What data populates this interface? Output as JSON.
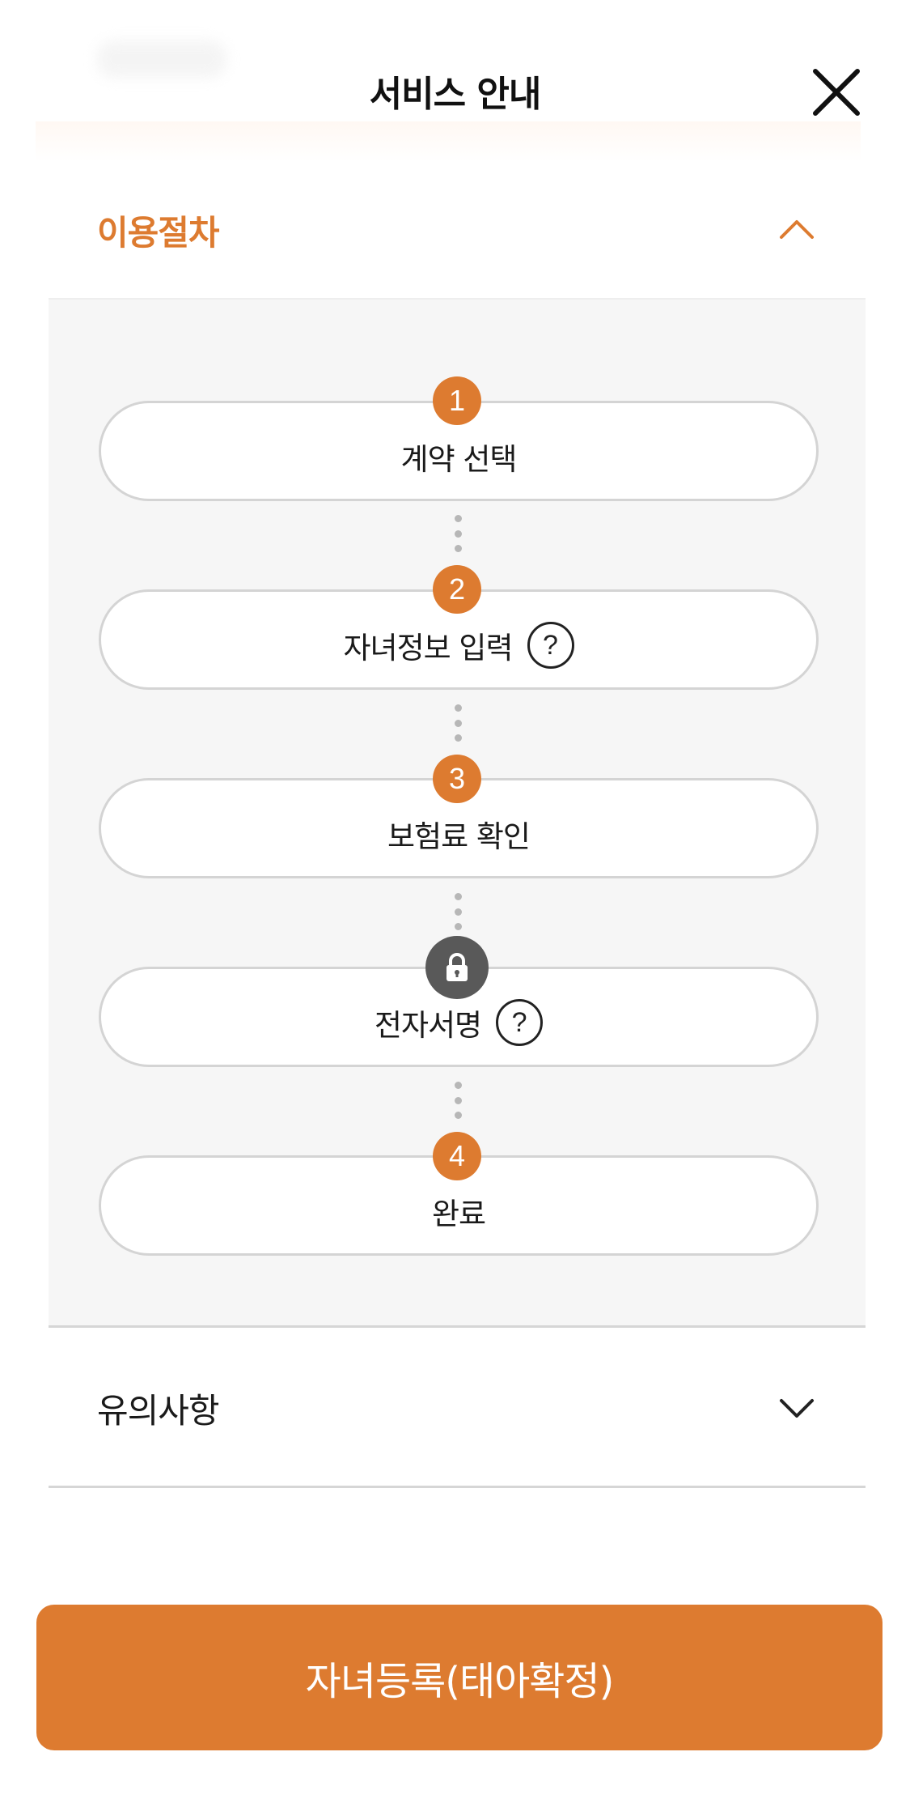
{
  "header": {
    "title": "서비스 안내",
    "close_icon": "close-icon"
  },
  "sections": [
    {
      "title": "이용절차",
      "expanded": true,
      "color": "#dd7b30"
    },
    {
      "title": "유의사항",
      "expanded": false
    }
  ],
  "steps": [
    {
      "badge": "1",
      "label": "계약 선택",
      "help": false
    },
    {
      "badge": "2",
      "label": "자녀정보 입력",
      "help": true
    },
    {
      "badge": "3",
      "label": "보험료 확인",
      "help": false
    },
    {
      "badge_icon": "lock-icon",
      "label": "전자서명",
      "help": true
    },
    {
      "badge": "4",
      "label": "완료",
      "help": false
    }
  ],
  "help_symbol": "?",
  "cta": {
    "label": "자녀등록(태아확정)",
    "color": "#dd7b30"
  }
}
